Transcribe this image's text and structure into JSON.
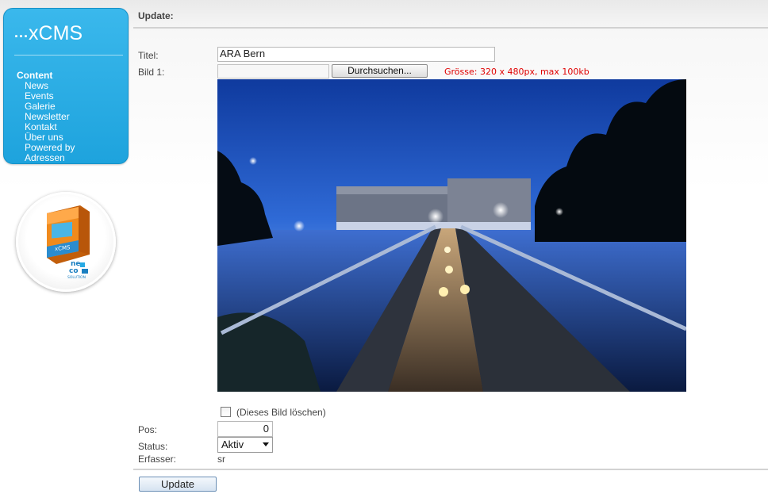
{
  "sidebar": {
    "logo": {
      "dots": "...",
      "text": "xCMS"
    },
    "nav_heading": "Content",
    "items": [
      {
        "label": "News"
      },
      {
        "label": "Events"
      },
      {
        "label": "Galerie"
      },
      {
        "label": "Newsletter"
      },
      {
        "label": "Kontakt"
      },
      {
        "label": "Über uns"
      },
      {
        "label": "Powered by"
      },
      {
        "label": "Adressen"
      }
    ],
    "accent_color": "#27aae4"
  },
  "page": {
    "title": "Update:"
  },
  "form": {
    "titel_label": "Titel:",
    "titel_value": "ARA Bern",
    "bild_label": "Bild 1:",
    "file_path_value": "",
    "browse_label": "Durchsuchen...",
    "size_hint": "Grösse: 320 x 480px, max 100kb",
    "size_hint_color": "#e00000",
    "image_description_icon": "photo-night-footbridge",
    "delete_label": "(Dieses Bild löschen)",
    "delete_checked": false,
    "pos_label": "Pos:",
    "pos_value": "0",
    "status_label": "Status:",
    "status_value": "Aktiv",
    "erfasser_label": "Erfasser:",
    "erfasser_value": "sr",
    "submit_label": "Update"
  }
}
